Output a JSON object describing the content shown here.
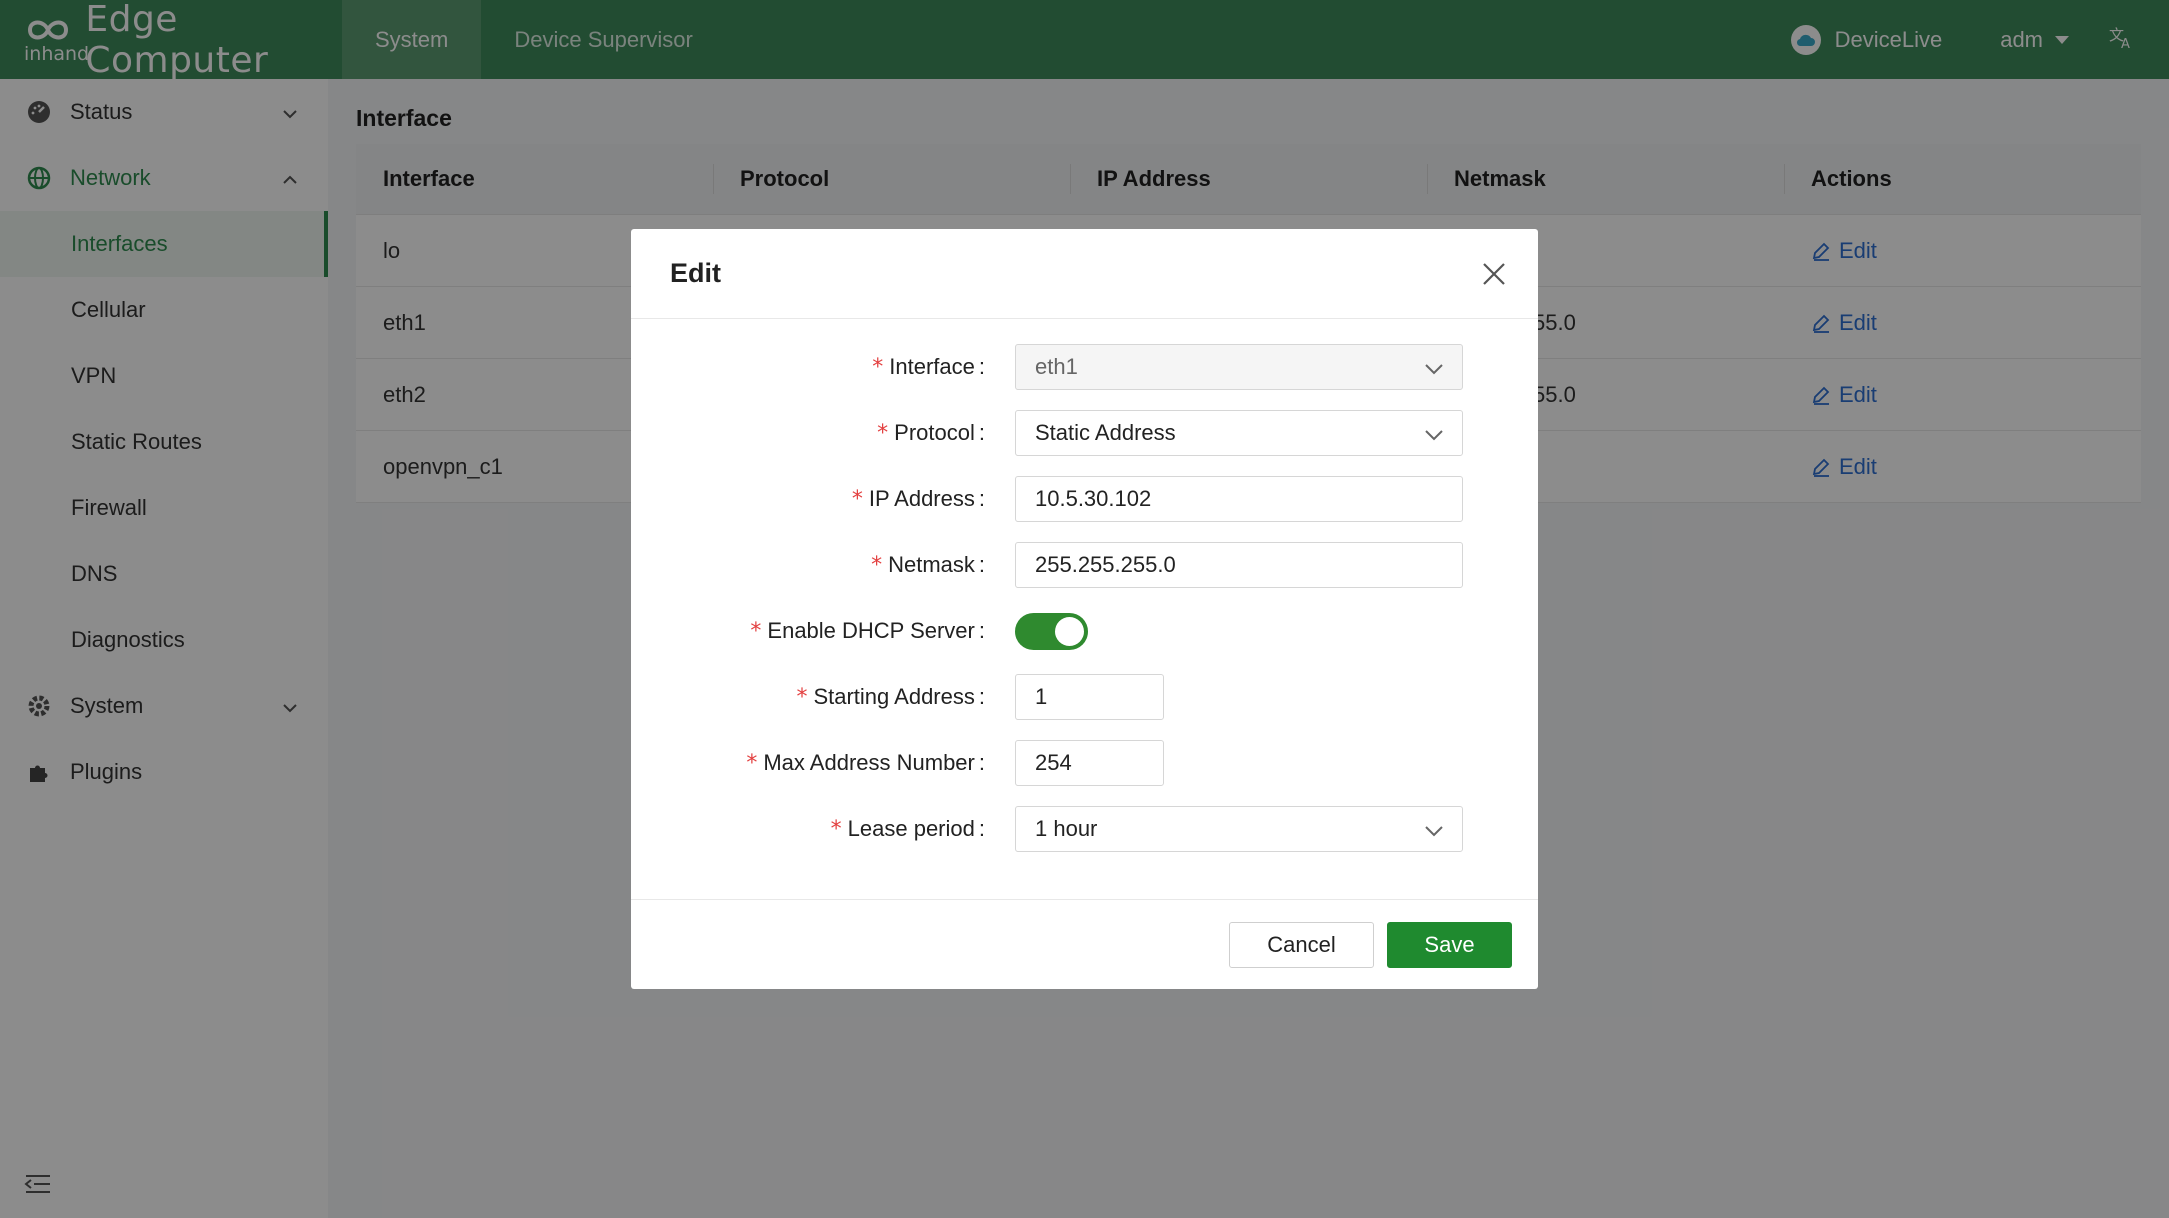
{
  "brand": {
    "logo_text": "inhand",
    "name": "Edge Computer"
  },
  "topnav": {
    "tabs": [
      {
        "label": "System"
      },
      {
        "label": "Device Supervisor"
      }
    ]
  },
  "topright": {
    "devicelive": "DeviceLive",
    "user": "adm"
  },
  "sidebar": {
    "status": "Status",
    "network": "Network",
    "network_items": [
      "Interfaces",
      "Cellular",
      "VPN",
      "Static Routes",
      "Firewall",
      "DNS",
      "Diagnostics"
    ],
    "system": "System",
    "plugins": "Plugins"
  },
  "page": {
    "title": "Interface",
    "table": {
      "headers": [
        "Interface",
        "Protocol",
        "IP Address",
        "Netmask",
        "Actions"
      ],
      "rows": [
        {
          "interface": "lo",
          "netmask_partial": "",
          "action": "Edit"
        },
        {
          "interface": "eth1",
          "netmask_partial": "55.0",
          "action": "Edit"
        },
        {
          "interface": "eth2",
          "netmask_partial": "55.0",
          "action": "Edit"
        },
        {
          "interface": "openvpn_c1",
          "netmask_partial": "",
          "action": "Edit"
        }
      ]
    }
  },
  "modal": {
    "title": "Edit",
    "fields": {
      "interface": {
        "label": "Interface",
        "value": "eth1"
      },
      "protocol": {
        "label": "Protocol",
        "value": "Static Address"
      },
      "ip": {
        "label": "IP Address",
        "value": "10.5.30.102"
      },
      "netmask": {
        "label": "Netmask",
        "value": "255.255.255.0"
      },
      "dhcp": {
        "label": "Enable DHCP Server",
        "enabled": true
      },
      "start": {
        "label": "Starting Address",
        "value": "1"
      },
      "max": {
        "label": "Max Address Number",
        "value": "254"
      },
      "lease": {
        "label": "Lease period",
        "value": "1 hour"
      }
    },
    "cancel": "Cancel",
    "save": "Save"
  },
  "colors": {
    "primary": "#3f8a5b",
    "accent_green": "#1f8a2f",
    "link_blue": "#2f6fd1",
    "required_red": "#e34040"
  }
}
